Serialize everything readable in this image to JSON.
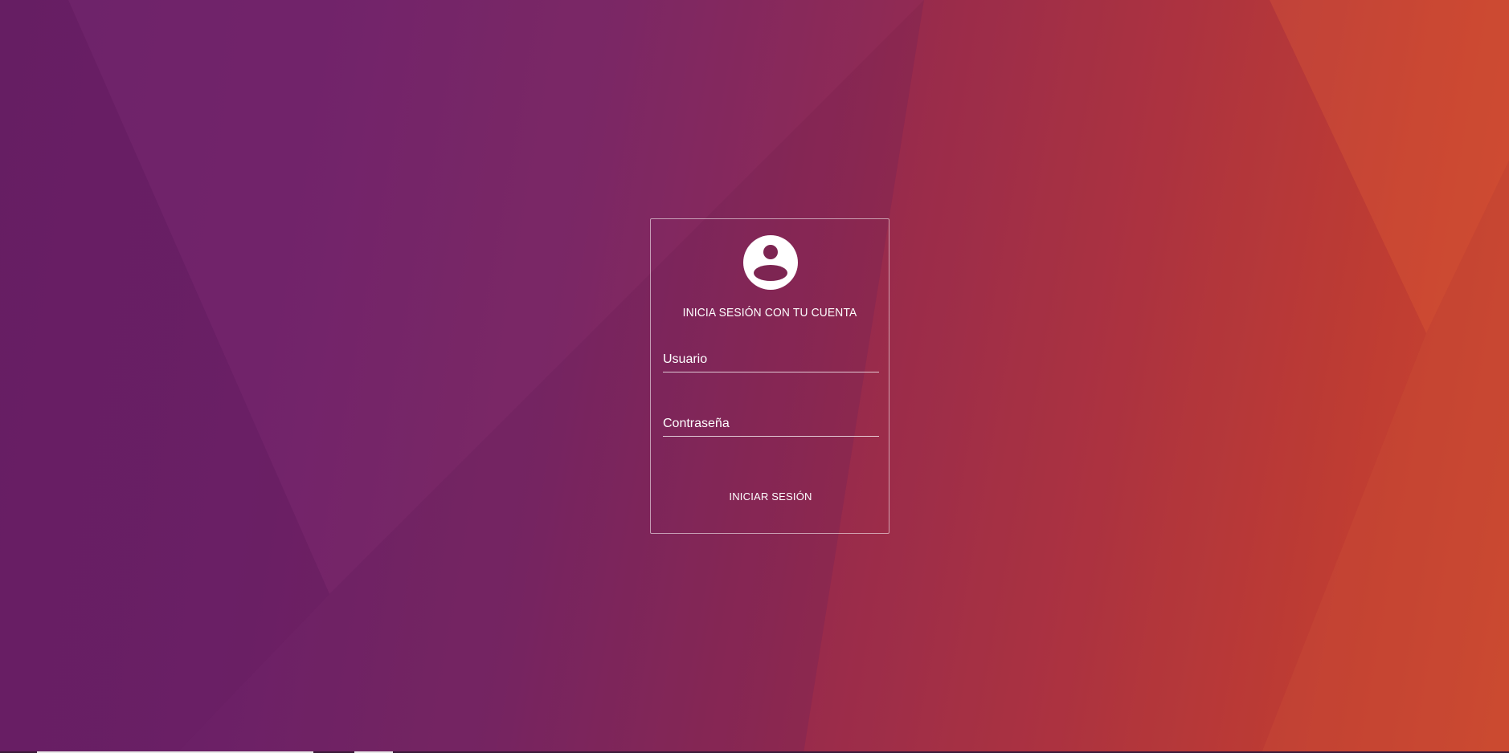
{
  "login": {
    "title": "INICIA SESIÓN CON TU CUENTA",
    "username_placeholder": "Usuario",
    "password_placeholder": "Contraseña",
    "submit_label": "INICIAR SESIÓN"
  },
  "icons": {
    "avatar": "account-circle-icon"
  },
  "colors": {
    "background_start": "#6b2168",
    "background_end": "#cf4a2c",
    "text": "#ffffff"
  }
}
